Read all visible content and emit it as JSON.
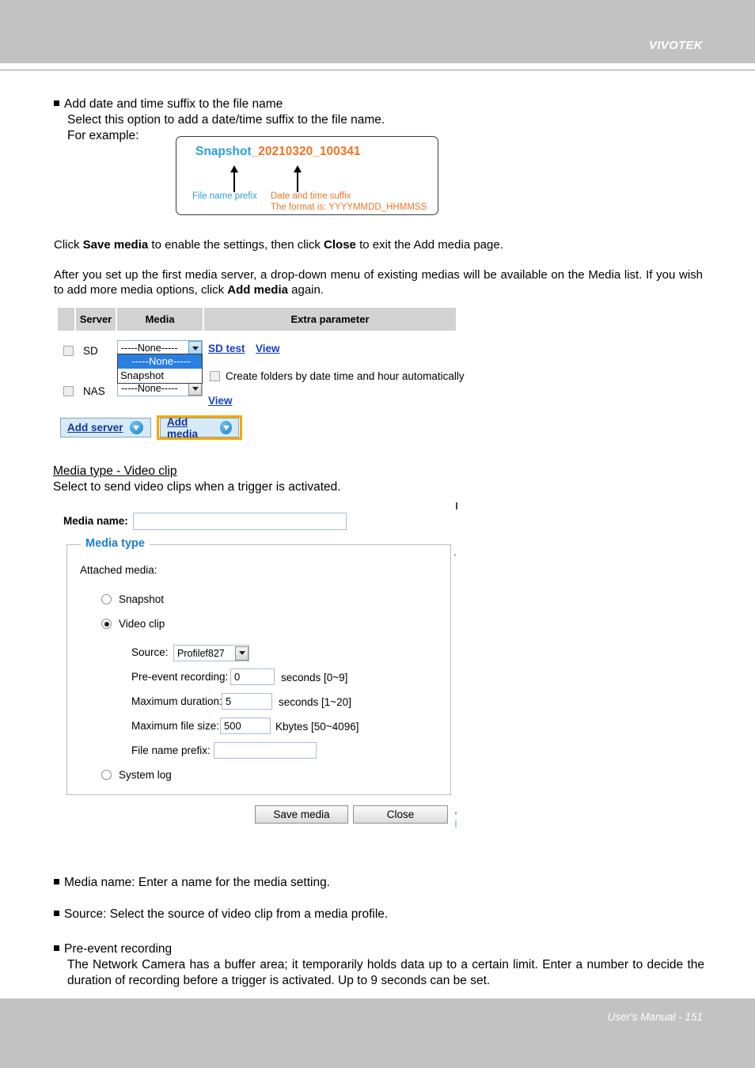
{
  "header": {
    "brand": "VIVOTEK"
  },
  "footer": {
    "text": "User's Manual - 151"
  },
  "intro": {
    "bullet_title": "Add date and time suffix to the file name",
    "line1": "Select this option to add a date/time suffix to the file name.",
    "line2": "For example:"
  },
  "example_box": {
    "prefix": "Snapshot",
    "suffix": "_20210320_100341",
    "label_prefix": "File name prefix",
    "label_suffix": "Date and time suffix",
    "label_format": "The format is: YYYYMMDD_HHMMSS"
  },
  "paragraphs": {
    "save_close": {
      "p1": "Click ",
      "b1": "Save media",
      "p2": " to enable the settings, then click ",
      "b2": "Close",
      "p3": " to exit the Add media page."
    },
    "dropdown_note": {
      "p1": "After you set up the first media server, a drop-down menu of existing medias will be available on the Media list. If you wish to add more media options, click ",
      "b1": "Add media",
      "p2": " again."
    }
  },
  "media_list": {
    "columns": [
      "",
      "Server",
      "Media",
      "Extra parameter"
    ],
    "rows": [
      {
        "server": "SD",
        "media_value": "-----None-----",
        "links": [
          "SD test",
          "View"
        ]
      },
      {
        "server": "NAS",
        "media_value": "-----None-----",
        "links": [
          "View"
        ]
      }
    ],
    "open_dropdown_options": [
      "-----None-----",
      "Snapshot"
    ],
    "open_dropdown_selected": "-----None-----",
    "extra_checkbox_label": "Create folders by date time and hour automatically",
    "add_server_label": "Add server",
    "add_media_label": "Add media"
  },
  "section": {
    "heading": "Media type - Video clip",
    "subtext": "Select to send video clips when a trigger is activated."
  },
  "form": {
    "media_name_label": "Media name:",
    "media_name_value": "",
    "legend": "Media type",
    "attached_media_label": "Attached media:",
    "options": [
      {
        "label": "Snapshot",
        "checked": false
      },
      {
        "label": "Video clip",
        "checked": true
      },
      {
        "label": "System log",
        "checked": false
      }
    ],
    "source_label": "Source:",
    "source_value": "Profilef827",
    "fields": [
      {
        "label": "Pre-event recording:",
        "value": "0",
        "unit": "seconds [0~9]"
      },
      {
        "label": "Maximum duration:",
        "value": "5",
        "unit": "seconds [1~20]"
      },
      {
        "label": "Maximum file size:",
        "value": "500",
        "unit": "Kbytes [50~4096]"
      },
      {
        "label": "File name prefix:",
        "value": "",
        "unit": ""
      }
    ],
    "save_label": "Save media",
    "close_label": "Close"
  },
  "notes": [
    {
      "title": "Media name: Enter a name for the media setting.",
      "body": ""
    },
    {
      "title": "Source: Select the source of video clip from a media profile.",
      "body": ""
    },
    {
      "title": "Pre-event recording",
      "body": "The Network Camera has a buffer area; it temporarily holds data up to a certain limit. Enter a number to decide the duration of recording before a trigger is activated. Up to 9 seconds can be set."
    }
  ],
  "colors": {
    "header_bg": "#c2c2c2",
    "accent_blue": "#1a7fd4",
    "accent_orange": "#ef7523",
    "highlight": "#f5a800",
    "link": "#1a3fbf"
  }
}
